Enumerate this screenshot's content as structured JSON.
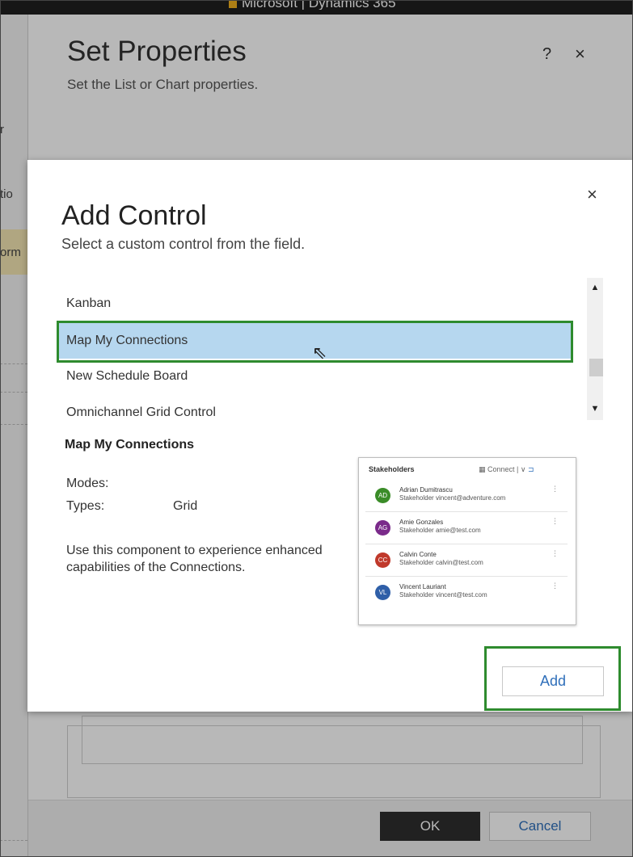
{
  "background_app": {
    "brand_text": "Microsoft | Dynamics 365",
    "left_fragments": [
      "r",
      "tio",
      "orm"
    ]
  },
  "set_properties": {
    "title": "Set Properties",
    "subtitle": "Set the List or Chart properties.",
    "help_label": "?",
    "close_label": "×",
    "ok_label": "OK",
    "cancel_label": "Cancel"
  },
  "add_control": {
    "title": "Add Control",
    "subtitle": "Select a custom control from the field.",
    "close_label": "×",
    "controls": [
      {
        "label": "Kanban",
        "selected": false
      },
      {
        "label": "Map My Connections",
        "selected": true
      },
      {
        "label": "New Schedule Board",
        "selected": false
      },
      {
        "label": "Omnichannel Grid Control",
        "selected": false
      }
    ],
    "details": {
      "name": "Map My Connections",
      "modes_label": "Modes:",
      "types_label": "Types:",
      "types_value": "Grid",
      "description": "Use this component to experience enhanced capabilities of the Connections."
    },
    "preview": {
      "header": "Stakeholders",
      "connect_label": "Connect",
      "rows": [
        {
          "initials": "AD",
          "name": "Adrian Dumitrascu",
          "role": "Stakeholder",
          "email": "vincent@adventure.com",
          "color": "#3a8c28"
        },
        {
          "initials": "AG",
          "name": "Amie Gonzales",
          "role": "Stakeholder",
          "email": "amie@test.com",
          "color": "#7a2a8a"
        },
        {
          "initials": "CC",
          "name": "Calvin Conte",
          "role": "Stakeholder",
          "email": "calvin@test.com",
          "color": "#c0392b"
        },
        {
          "initials": "VL",
          "name": "Vincent Lauriant",
          "role": "Stakeholder",
          "email": "vincent@test.com",
          "color": "#2f5fa8"
        }
      ]
    },
    "add_label": "Add"
  },
  "colors": {
    "selection_bg": "#b6d7ef",
    "highlight_outline": "#2e8b2e",
    "link_blue": "#2f6fba"
  }
}
